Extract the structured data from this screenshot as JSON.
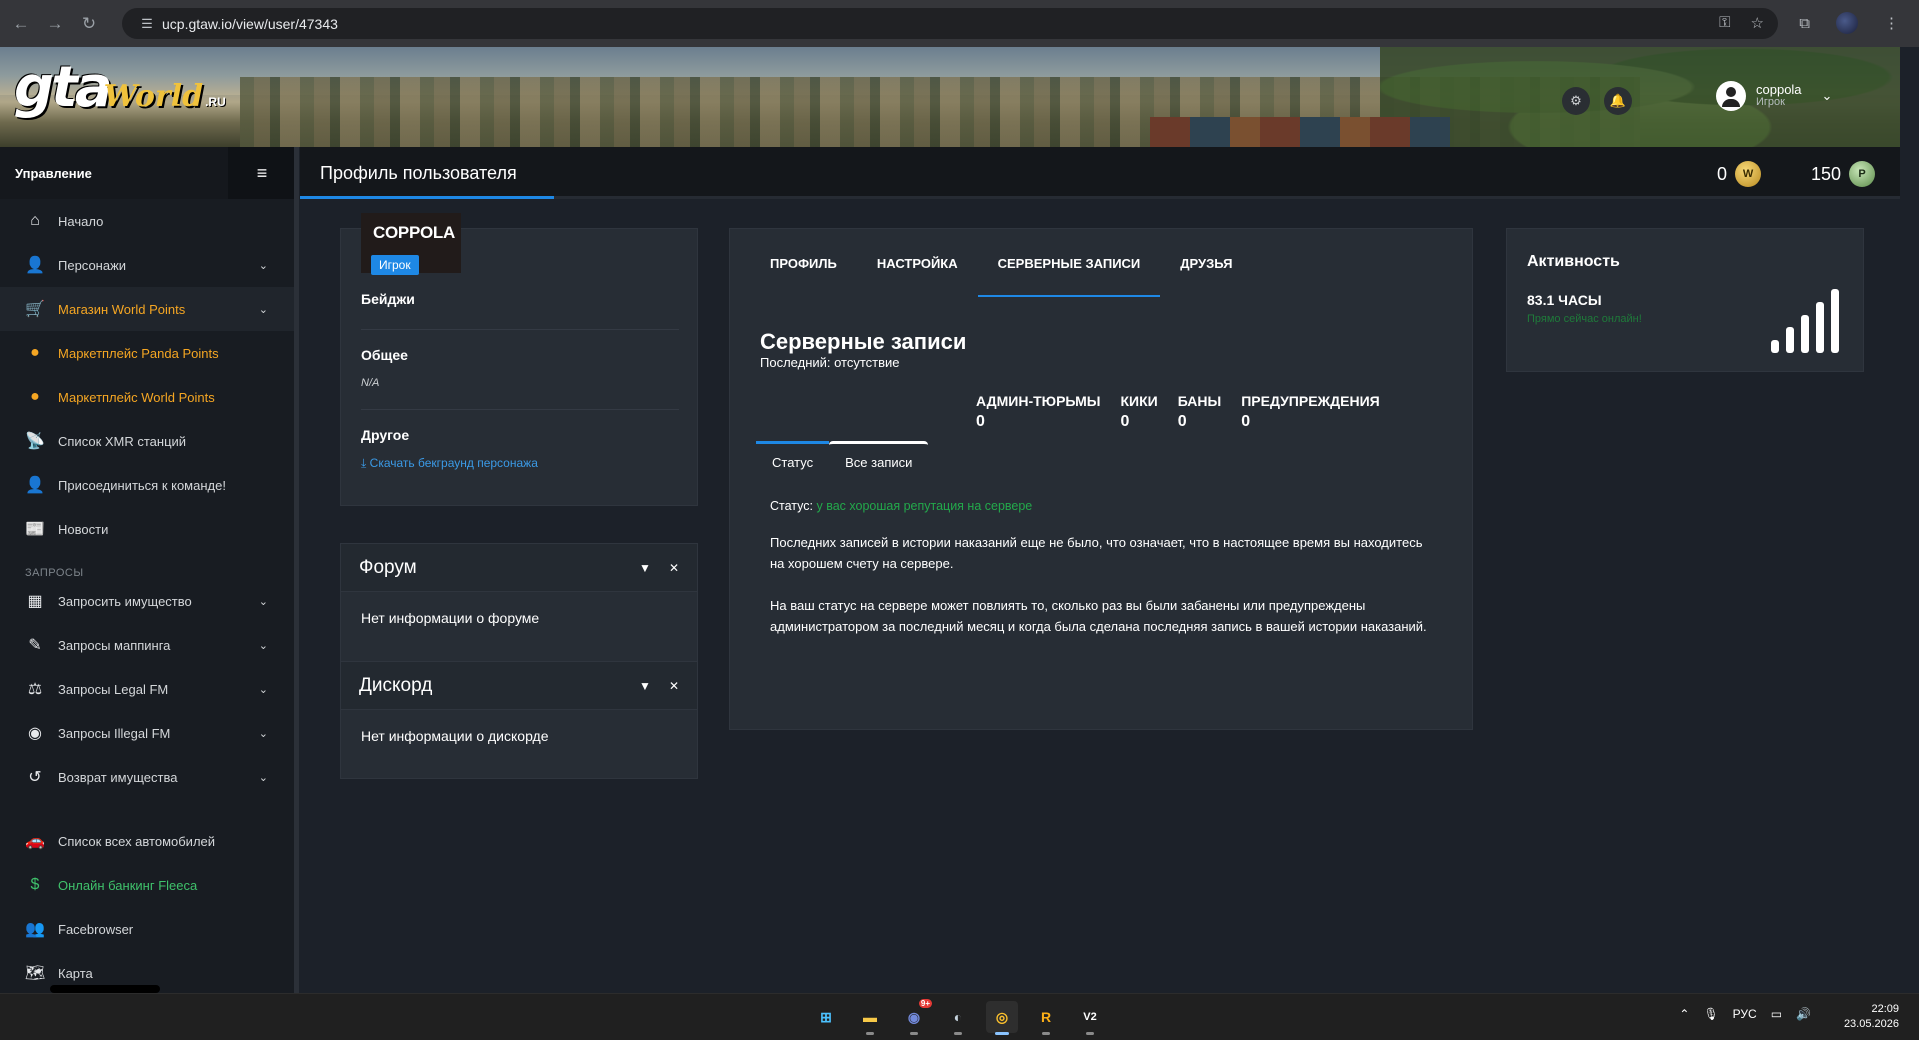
{
  "browser": {
    "url": "ucp.gtaw.io/view/user/47343",
    "back_icon": "←",
    "forward_icon": "→",
    "reload_icon": "↻"
  },
  "logo": {
    "gta": "gta",
    "world": "World",
    "ru": ".RU"
  },
  "header": {
    "user_name": "coppola",
    "user_role": "Игрок"
  },
  "sidebar": {
    "title": "Управление",
    "items": [
      {
        "label": "Начало",
        "icon": "⌂"
      },
      {
        "label": "Персонажи",
        "icon": "👤"
      },
      {
        "label": "Магазин World Points",
        "icon": "🛒"
      },
      {
        "label": "Маркетплейс Panda Points",
        "icon": "●"
      },
      {
        "label": "Маркетплейс World Points",
        "icon": "●"
      },
      {
        "label": "Список XMR станций",
        "icon": "📡"
      },
      {
        "label": "Присоединиться к команде!",
        "icon": "👤"
      },
      {
        "label": "Новости",
        "icon": "📰"
      }
    ],
    "section_label": "ЗАПРОСЫ",
    "request_items": [
      {
        "label": "Запросить имущество",
        "icon": "▦"
      },
      {
        "label": "Запросы маппинга",
        "icon": "✎"
      },
      {
        "label": "Запросы Legal FM",
        "icon": "⚖"
      },
      {
        "label": "Запросы Illegal FM",
        "icon": "◉"
      },
      {
        "label": "Возврат имущества",
        "icon": "↺"
      }
    ],
    "bottom_items": [
      {
        "label": "Список всех автомобилей",
        "icon": "🚗"
      },
      {
        "label": "Онлайн банкинг Fleeca",
        "icon": "$"
      },
      {
        "label": "Facebrowser",
        "icon": "👥"
      },
      {
        "label": "Карта",
        "icon": "🗺"
      }
    ]
  },
  "topbar": {
    "page_title": "Профиль пользователя",
    "world_points": "0",
    "panda_points": "150"
  },
  "profile": {
    "name": "COPPOLA",
    "role": "Игрок",
    "badges_label": "Бейджи",
    "general_label": "Общее",
    "general_value": "N/A",
    "other_label": "Другое",
    "download_link": "Скачать бекграунд персонажа"
  },
  "forum": {
    "title": "Форум",
    "body": "Нет информации о форуме"
  },
  "discord": {
    "title": "Дискорд",
    "body": "Нет информации о дискорде"
  },
  "main": {
    "tabs": [
      "ПРОФИЛЬ",
      "НАСТРОЙКА",
      "СЕРВЕРНЫЕ ЗАПИСИ",
      "ДРУЗЬЯ"
    ],
    "title": "Серверные записи",
    "subtitle": "Последний: отсутствие",
    "stats": [
      {
        "label": "АДМИН-ТЮРЬМЫ",
        "value": "0"
      },
      {
        "label": "КИКИ",
        "value": "0"
      },
      {
        "label": "БАНЫ",
        "value": "0"
      },
      {
        "label": "ПРЕДУПРЕЖДЕНИЯ",
        "value": "0"
      }
    ],
    "sub_tabs": [
      "Статус",
      "Все записи"
    ],
    "status_label": "Статус:",
    "status_value": "у вас хорошая репутация на сервере",
    "para1": "Последних записей в истории наказаний еще не было, что означает, что в настоящее время вы находитесь на хорошем счету на сервере.",
    "para2": "На ваш статус на сервере может повлиять то, сколько раз вы были забанены или предупреждены администратором за последний месяц и когда была сделана последняя запись в вашей истории наказаний."
  },
  "activity": {
    "title": "Активность",
    "hours": "83.1 ЧАСЫ",
    "online": "Прямо сейчас онлайн!",
    "bar_levels": [
      0.2,
      0.4,
      0.6,
      0.8,
      1.0
    ]
  },
  "taskbar": {
    "lang": "РУС",
    "time": "22:09",
    "date": "23.05.2026",
    "discord_badge": "9+"
  },
  "colors": {
    "accent": "#1e88e5",
    "orange": "#f5a623",
    "green": "#23a94b"
  }
}
